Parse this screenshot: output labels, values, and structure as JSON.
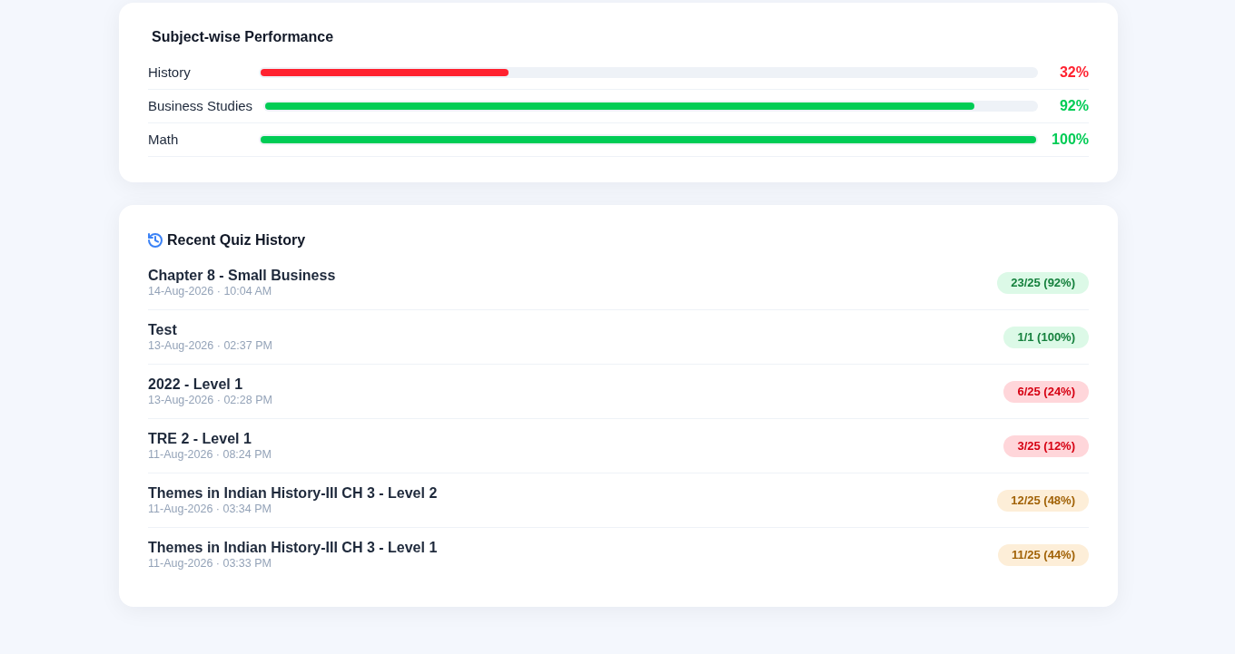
{
  "performance": {
    "title": "Subject-wise Performance",
    "subjects": [
      {
        "name": "History",
        "level": 0.32,
        "percent": "32%",
        "color": "#ff2230"
      },
      {
        "name": "Business Studies",
        "level": 0.92,
        "percent": "92%",
        "color": "#00cc55"
      },
      {
        "name": "Math",
        "level": 1,
        "percent": "100%",
        "color": "#00cc55"
      }
    ]
  },
  "quiz_history": {
    "title": "Recent Quiz History",
    "quizzes": [
      {
        "title": "Chapter 8 - Small Business",
        "date": "14-Aug-2026 · 10:04 AM",
        "score": "23/25 (92%)",
        "color": "#15803d"
      },
      {
        "title": "Test",
        "date": "13-Aug-2026 · 02:37 PM",
        "score": "1/1 (100%)",
        "color": "#15803d"
      },
      {
        "title": "2022 - Level 1",
        "date": "13-Aug-2026 · 02:28 PM",
        "score": "6/25 (24%)",
        "color": "#d60012"
      },
      {
        "title": "TRE 2 - Level 1",
        "date": "11-Aug-2026 · 08:24 PM",
        "score": "3/25 (12%)",
        "color": "#d60012"
      },
      {
        "title": "Themes in Indian History-III CH 3 - Level 2",
        "date": "11-Aug-2026 · 03:34 PM",
        "score": "12/25 (48%)",
        "color": "#a16207"
      },
      {
        "title": "Themes in Indian History-III CH 3 - Level 1",
        "date": "11-Aug-2026 · 03:33 PM",
        "score": "11/25 (44%)",
        "color": "#a16207"
      }
    ]
  }
}
